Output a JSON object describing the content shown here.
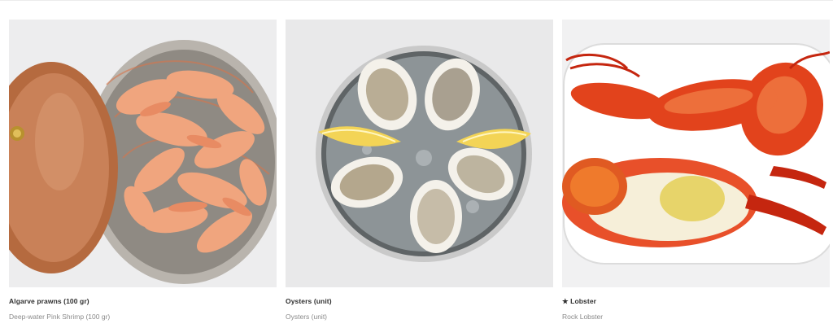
{
  "menu": {
    "items": [
      {
        "name": "Algarve prawns (100 gr)",
        "description": "Deep-water Pink Shrimp (100 gr)"
      },
      {
        "name": "Oysters (unit)",
        "description": "Oysters (unit)"
      },
      {
        "name": "★ Lobster",
        "description": "Rock Lobster"
      }
    ]
  },
  "colors": {
    "title": "#2f2f2f",
    "subtitle": "#8a8a8a",
    "prawn": "#f0a57e",
    "copper": "#c57a4e",
    "lobster": "#e2431c"
  }
}
